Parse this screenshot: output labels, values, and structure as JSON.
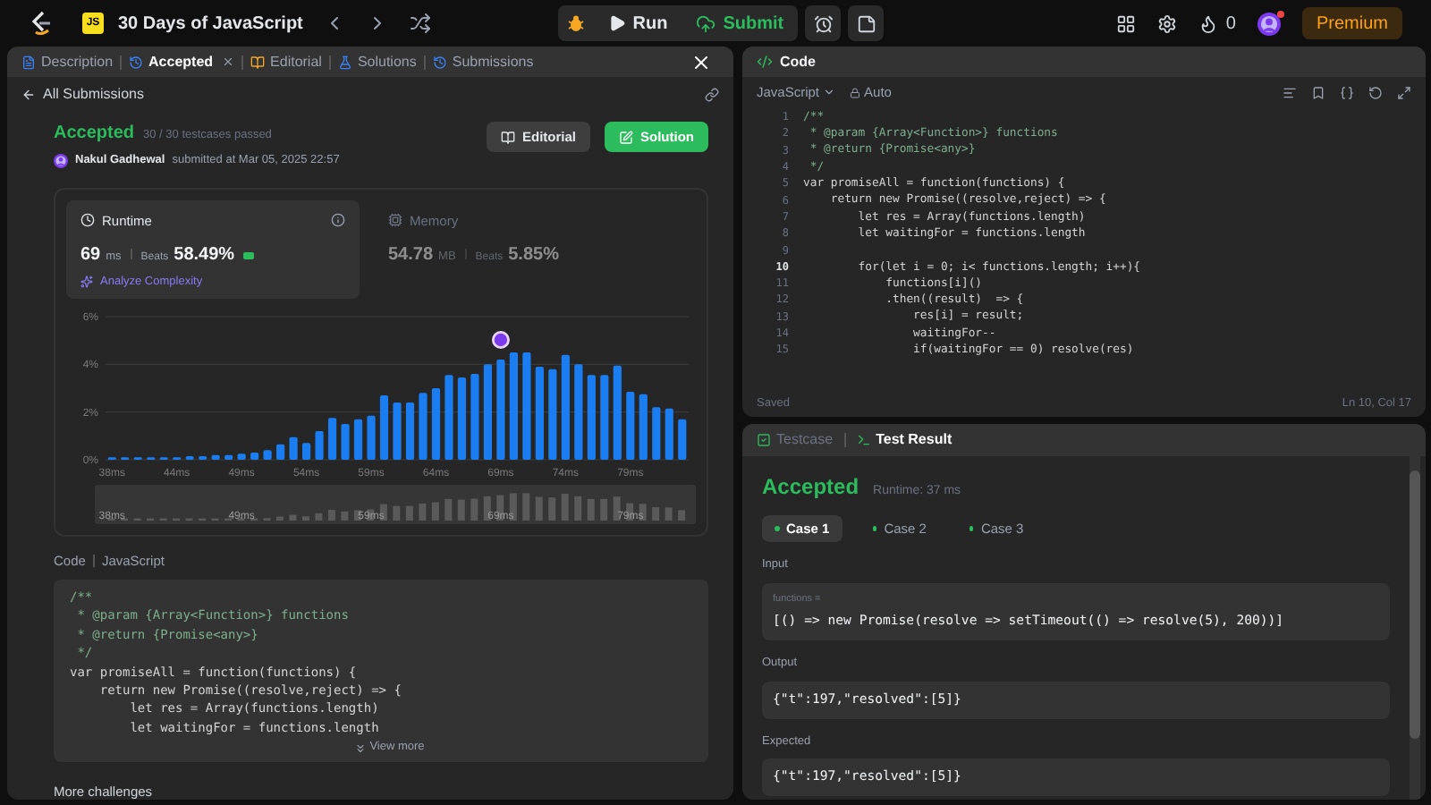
{
  "topbar": {
    "badge": "JS",
    "title": "30 Days of JavaScript",
    "actions": [
      {
        "label": "Run",
        "kind": "run"
      },
      {
        "label": "Submit",
        "kind": "submit"
      }
    ],
    "streak": "0",
    "notification": true,
    "premium": "Premium"
  },
  "left_panel": {
    "tabs": [
      {
        "label": "Description",
        "selected": false,
        "closable": false
      },
      {
        "label": "Accepted",
        "selected": true,
        "closable": true
      },
      {
        "label": "Editorial",
        "selected": false,
        "closable": false
      },
      {
        "label": "Solutions",
        "selected": false,
        "closable": false
      },
      {
        "label": "Submissions",
        "selected": false,
        "closable": false
      }
    ],
    "back_link": "All Submissions",
    "submission": {
      "status": "Accepted",
      "testcases": "30 / 30 testcases passed",
      "user": "Nakul Gadhewal",
      "submitted": "submitted at Mar 05, 2025 22:57",
      "buttons": [
        {
          "label": "Editorial",
          "kind": "secondary"
        },
        {
          "label": "Solution",
          "kind": "primary"
        }
      ]
    },
    "metrics": [
      {
        "label": "Runtime",
        "value": "69",
        "unit": "ms",
        "beats_label": "Beats",
        "beats": "58.49%",
        "selected": true
      },
      {
        "label": "Memory",
        "value": "54.78",
        "unit": "MB",
        "beats_label": "Beats",
        "beats": "5.85%",
        "selected": false
      }
    ],
    "analyze": "Analyze Complexity",
    "chart_data": {
      "type": "bar",
      "categories": [
        "38ms",
        null,
        null,
        null,
        null,
        "44ms",
        null,
        null,
        null,
        null,
        "49ms",
        null,
        null,
        null,
        null,
        "54ms",
        null,
        null,
        null,
        null,
        "59ms",
        null,
        null,
        null,
        null,
        "64ms",
        null,
        null,
        null,
        null,
        "69ms",
        null,
        null,
        null,
        null,
        "74ms",
        null,
        null,
        null,
        null,
        "79ms",
        null,
        null,
        null,
        null
      ],
      "series": [
        {
          "color": "#1a7ef2",
          "values": [
            0.1,
            0.1,
            0.1,
            0.1,
            0.1,
            0.1,
            0.15,
            0.15,
            0.2,
            0.2,
            0.25,
            0.3,
            0.4,
            0.65,
            0.95,
            0.7,
            1.2,
            1.75,
            1.5,
            1.7,
            1.85,
            2.7,
            2.4,
            2.4,
            2.8,
            3.0,
            3.55,
            3.45,
            3.6,
            4.0,
            4.2,
            4.5,
            4.5,
            3.9,
            3.8,
            4.4,
            4.0,
            3.55,
            3.55,
            3.95,
            2.85,
            2.75,
            2.2,
            2.15,
            1.7
          ]
        }
      ],
      "ylim": [
        0,
        6
      ],
      "yticks": [
        {
          "value": 0,
          "label": "0%"
        },
        {
          "value": 2,
          "label": "2%"
        },
        {
          "value": 4,
          "label": "4%"
        },
        {
          "value": 6,
          "label": "6%"
        }
      ],
      "annotations": [
        {
          "x": "69ms"
        }
      ]
    },
    "navigator_labels": [
      "38ms",
      "49ms",
      "59ms",
      "69ms",
      "79ms"
    ],
    "code_section": {
      "title": "Code",
      "language": "JavaScript",
      "view_more": "View more",
      "lines": [
        {
          "text": "/**",
          "kind": "comment"
        },
        {
          "text": " * @param {Array<Function>} functions",
          "kind": "comment"
        },
        {
          "text": " * @return {Promise<any>}",
          "kind": "comment"
        },
        {
          "text": " */",
          "kind": "comment"
        },
        {
          "text": "var promiseAll = function(functions) {",
          "kind": "code"
        },
        {
          "text": "    return new Promise((resolve,reject) => {",
          "kind": "code"
        },
        {
          "text": "        let res = Array(functions.length)",
          "kind": "code"
        },
        {
          "text": "        let waitingFor = functions.length",
          "kind": "code"
        }
      ]
    },
    "more_challenges": "More challenges"
  },
  "editor": {
    "title": "Code",
    "language": "JavaScript",
    "mode": "Auto",
    "status": "Saved",
    "cursor": "Ln 10, Col 17",
    "lines": [
      {
        "n": "1",
        "text": "/**",
        "kind": "comment",
        "current": false
      },
      {
        "n": "2",
        "text": " * @param {Array<Function>} functions",
        "kind": "comment",
        "current": false
      },
      {
        "n": "3",
        "text": " * @return {Promise<any>}",
        "kind": "comment",
        "current": false
      },
      {
        "n": "4",
        "text": " */",
        "kind": "comment",
        "current": false
      },
      {
        "n": "5",
        "text": "var promiseAll = function(functions) {",
        "kind": "code",
        "current": false
      },
      {
        "n": "6",
        "text": "    return new Promise((resolve,reject) => {",
        "kind": "code",
        "current": false
      },
      {
        "n": "7",
        "text": "        let res = Array(functions.length)",
        "kind": "code",
        "current": false
      },
      {
        "n": "8",
        "text": "        let waitingFor = functions.length",
        "kind": "code",
        "current": false
      },
      {
        "n": "9",
        "kind": "blank",
        "current": false
      },
      {
        "n": "10",
        "text": "        for(let i = 0; i< functions.length; i++){",
        "kind": "code",
        "current": true
      },
      {
        "n": "11",
        "text": "            functions[i]()",
        "kind": "code",
        "current": false
      },
      {
        "n": "12",
        "text": "            .then((result)  => {",
        "kind": "code",
        "current": false
      },
      {
        "n": "13",
        "text": "                res[i] = result;",
        "kind": "code",
        "current": false
      },
      {
        "n": "14",
        "text": "                waitingFor--",
        "kind": "code",
        "current": false
      },
      {
        "n": "15",
        "text": "                if(waitingFor == 0) resolve(res)",
        "kind": "code",
        "current": false
      }
    ]
  },
  "test_result": {
    "tabs": [
      {
        "label": "Testcase",
        "selected": false
      },
      {
        "label": "Test Result",
        "selected": true
      }
    ],
    "status": "Accepted",
    "runtime": "Runtime: 37 ms",
    "cases": [
      {
        "label": "Case 1",
        "selected": true,
        "passed": true
      },
      {
        "label": "Case 2",
        "selected": false,
        "passed": true
      },
      {
        "label": "Case 3",
        "selected": false,
        "passed": true
      }
    ],
    "sections": [
      {
        "label": "Input",
        "param": "functions =",
        "value": "[() => new Promise(resolve => setTimeout(() => resolve(5), 200))]"
      },
      {
        "label": "Output",
        "value": "{\"t\":197,\"resolved\":[5]}"
      },
      {
        "label": "Expected",
        "value": "{\"t\":197,\"resolved\":[5]}"
      }
    ]
  }
}
